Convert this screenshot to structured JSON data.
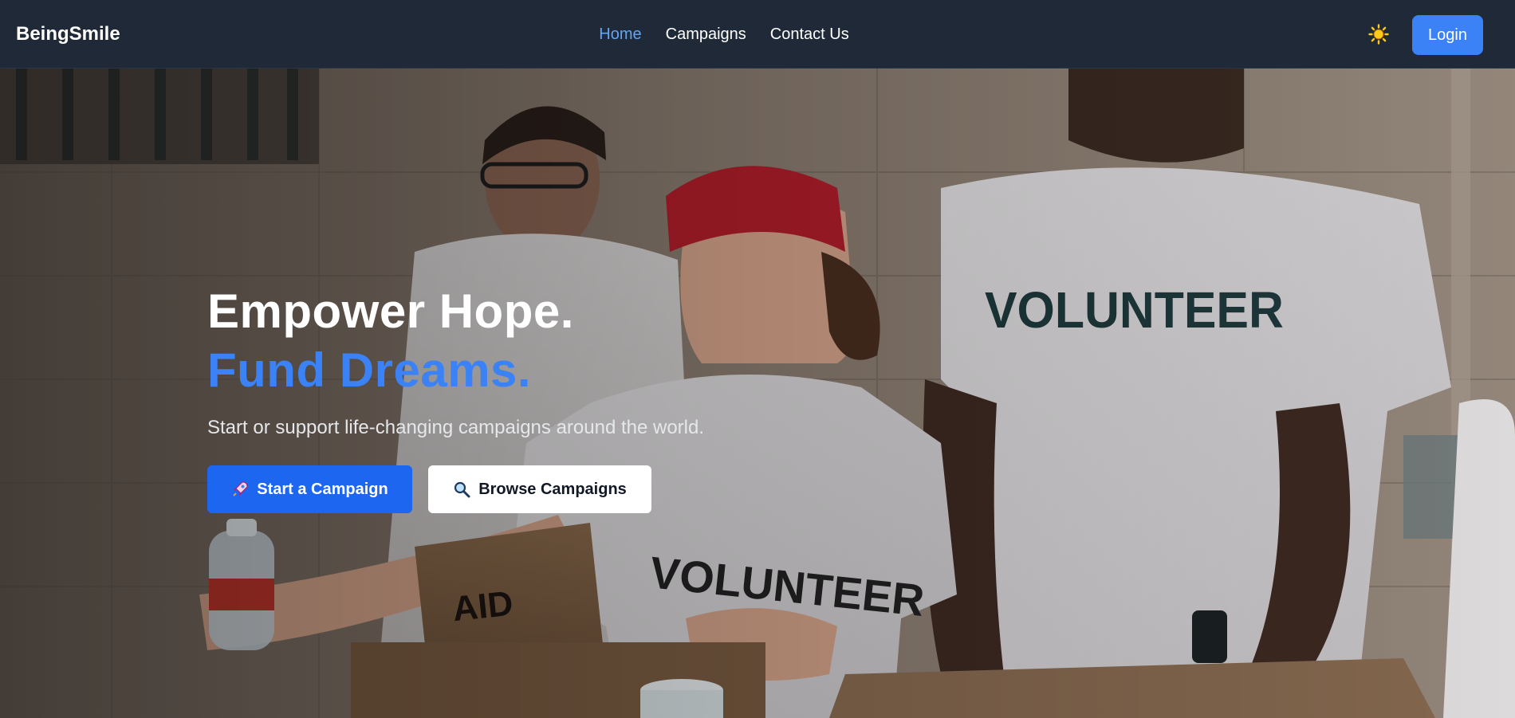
{
  "navbar": {
    "brand": "BeingSmile",
    "links": [
      {
        "label": "Home",
        "active": true
      },
      {
        "label": "Campaigns",
        "active": false
      },
      {
        "label": "Contact Us",
        "active": false
      }
    ],
    "theme_icon": "sun-icon",
    "login_label": "Login"
  },
  "hero": {
    "headline_line1": "Empower Hope.",
    "headline_line2": "Fund Dreams.",
    "subtitle": "Start or support life-changing campaigns around the world.",
    "primary_button": {
      "icon": "rocket-icon",
      "label": "Start a Campaign"
    },
    "secondary_button": {
      "icon": "magnifier-icon",
      "label": "Browse Campaigns"
    },
    "background_image": "volunteers in VOLUNTEER t-shirts with AID boxes"
  },
  "colors": {
    "nav_bg": "#1f2937",
    "accent": "#3b82f6",
    "primary_button": "#1d66f0",
    "active_link": "#60a5fa",
    "sun": "#facc15"
  }
}
